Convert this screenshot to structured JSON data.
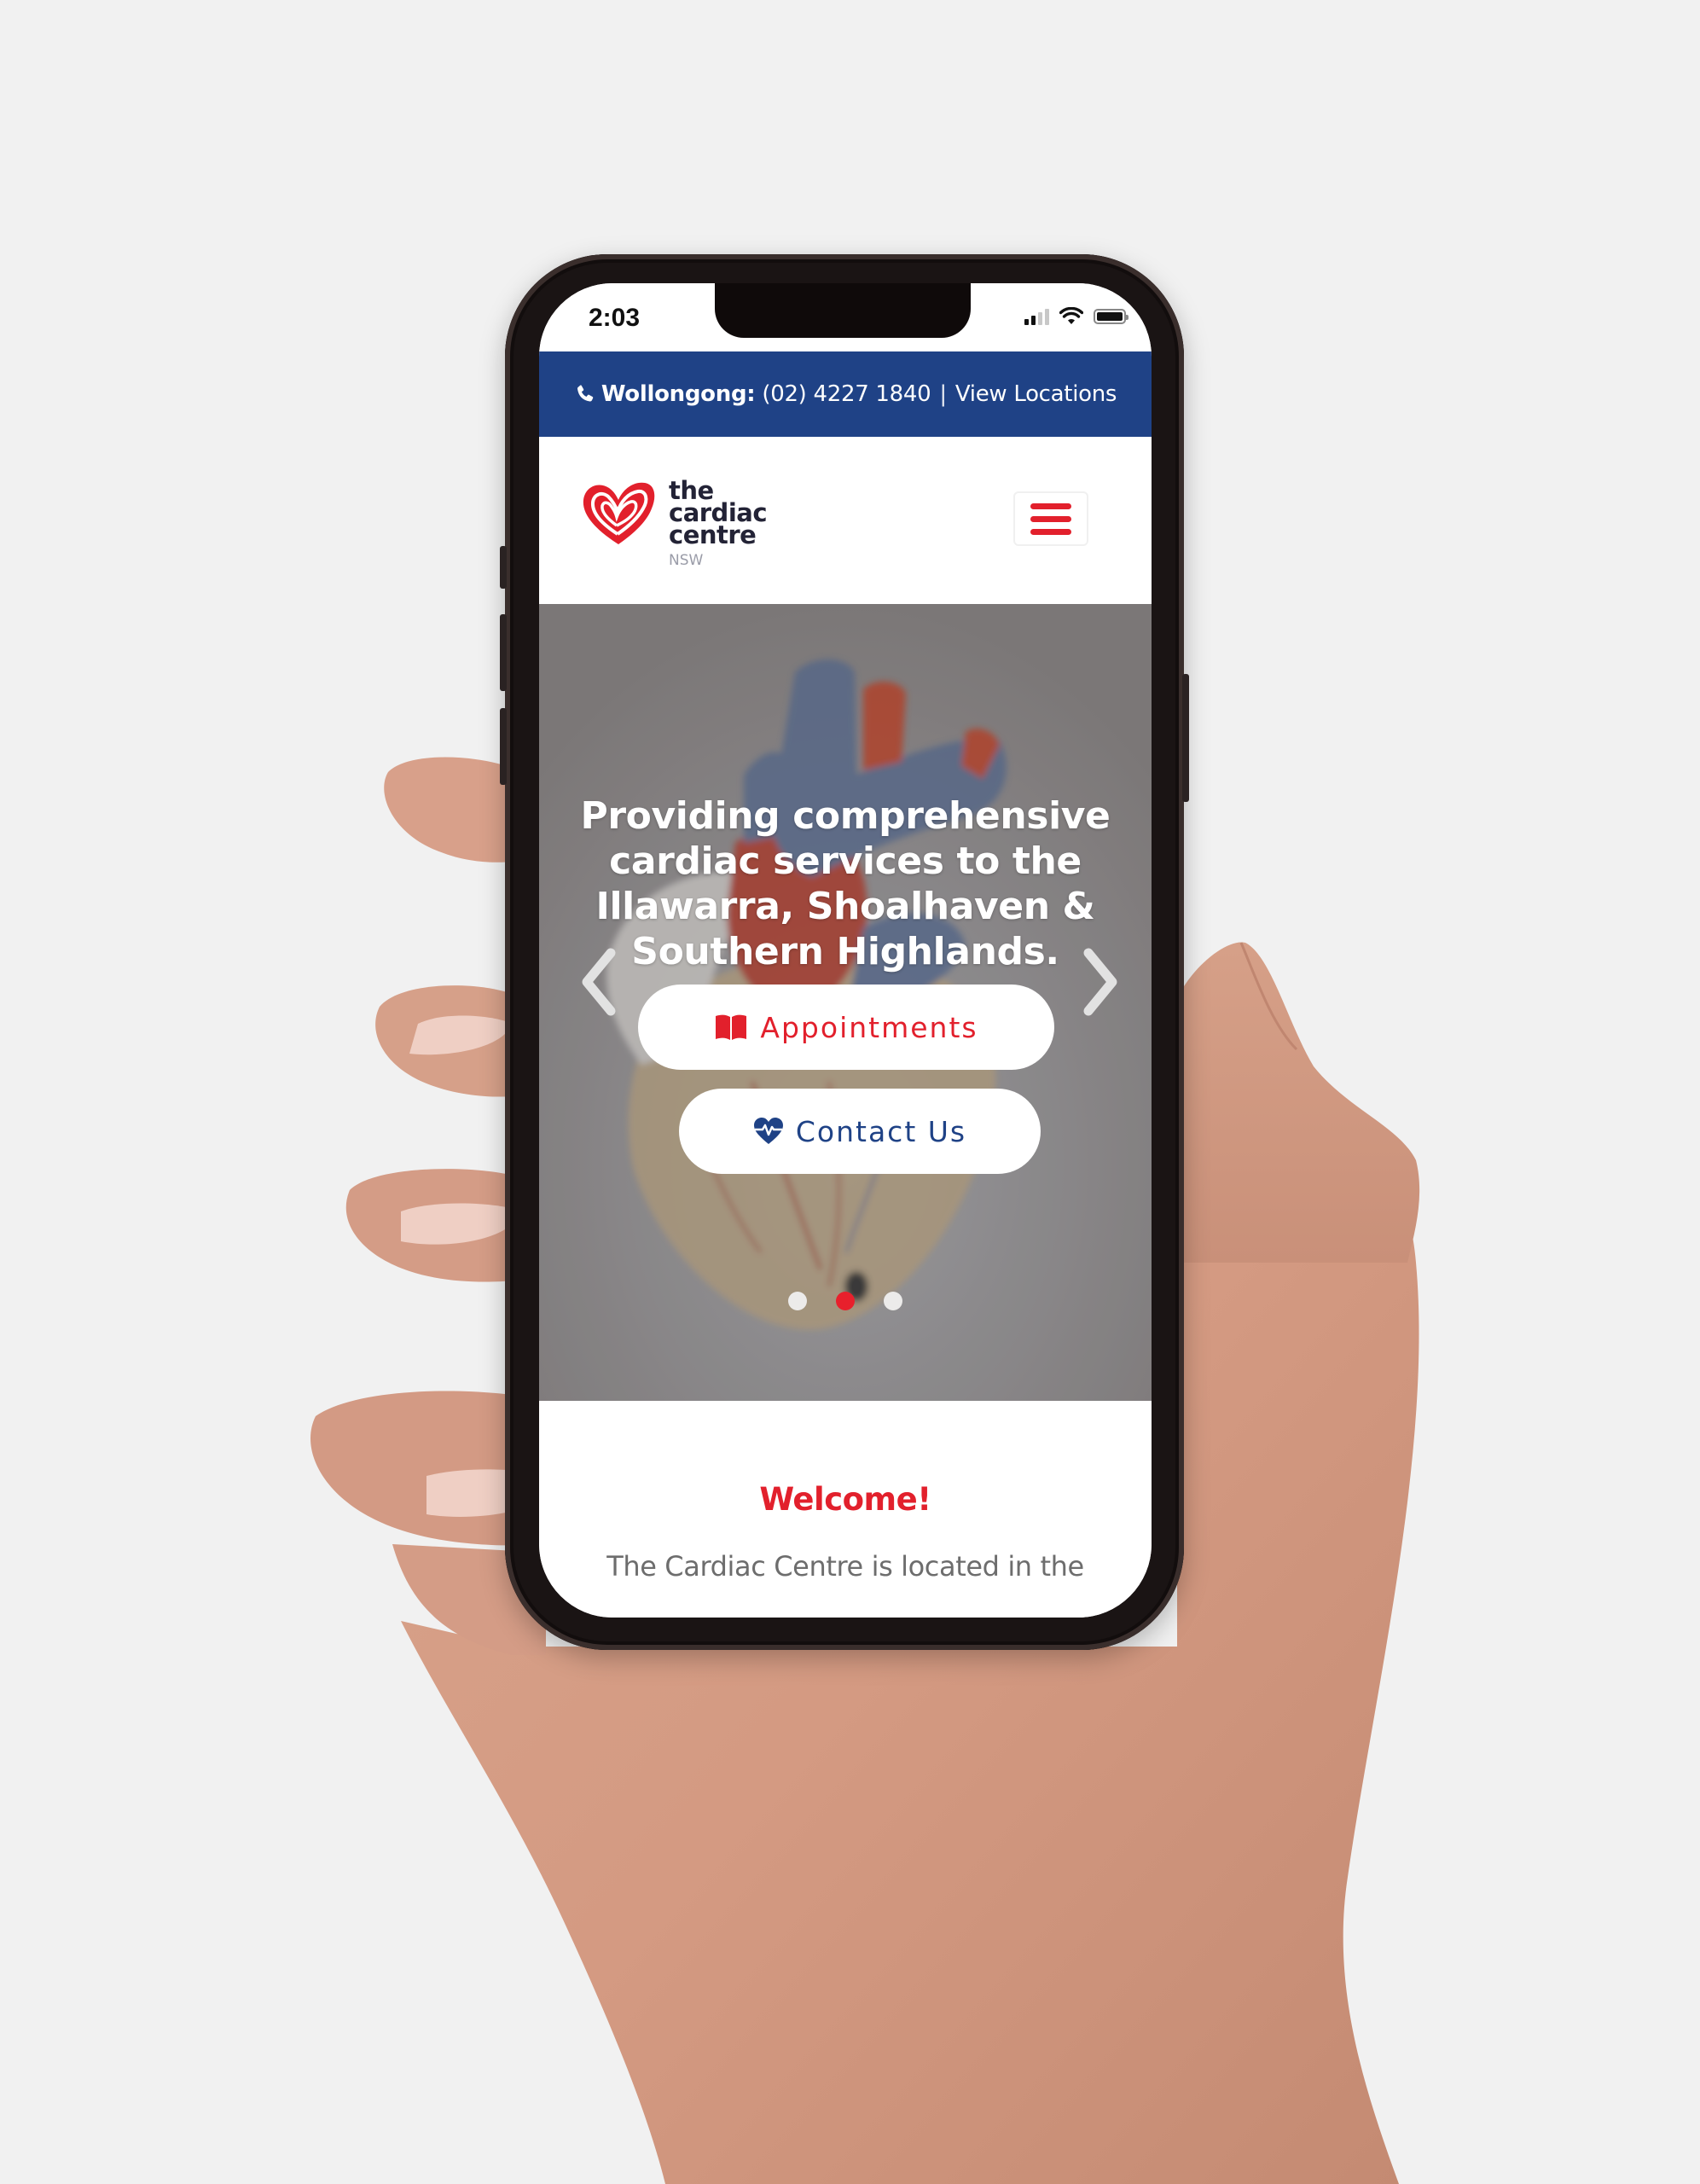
{
  "status_bar": {
    "time": "2:03",
    "signal_bars_filled": 2,
    "signal_bars_total": 4
  },
  "top_bar": {
    "location_label": "Wollongong:",
    "phone_number": "(02) 4227 1840",
    "separator": "|",
    "view_locations_link": "View Locations",
    "icon": "phone-icon",
    "background_color": "#1f4286"
  },
  "header": {
    "logo": {
      "line1": "the",
      "line2": "cardiac",
      "line3": "centre",
      "region": "NSW",
      "icon": "heart-logo-icon"
    },
    "menu_button_icon": "hamburger-menu-icon"
  },
  "hero": {
    "title": "Providing comprehensive cardiac services to the Illawarra, Shoalhaven & Southern Highlands.",
    "prev_icon": "chevron-left-icon",
    "next_icon": "chevron-right-icon",
    "buttons": [
      {
        "label": "Appointments",
        "icon": "book-open-icon",
        "color": "#e2202c"
      },
      {
        "label": "Contact Us",
        "icon": "heart-pulse-icon",
        "color": "#1f4286"
      }
    ],
    "slides": {
      "count": 3,
      "active_index": 1
    }
  },
  "welcome": {
    "heading": "Welcome!",
    "body": "The Cardiac Centre is located in the"
  },
  "colors": {
    "brand_red": "#e2202c",
    "brand_blue": "#1f4286",
    "background": "#f1f1f1"
  }
}
